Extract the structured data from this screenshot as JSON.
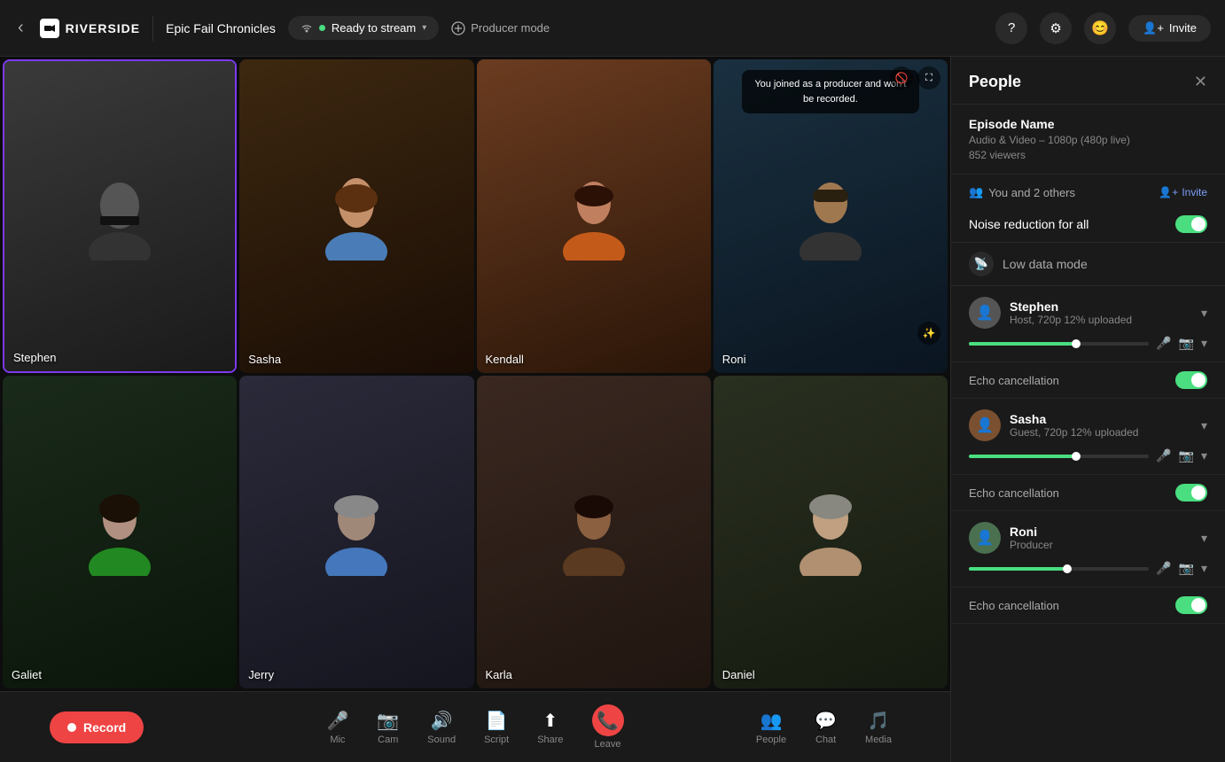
{
  "header": {
    "back_icon": "‹",
    "logo_text": "RIVERSIDE",
    "episode_name": "Epic Fail Chronicles",
    "stream_status": "Ready to stream",
    "producer_mode": "Producer mode",
    "invite_label": "Invite",
    "icons": [
      "?",
      "⚙",
      "😊"
    ]
  },
  "video_grid": [
    {
      "id": "stephen",
      "label": "Stephen",
      "active": true,
      "class": "vc-stephen"
    },
    {
      "id": "sasha",
      "label": "Sasha",
      "active": false,
      "class": "vc-sasha"
    },
    {
      "id": "kendall",
      "label": "Kendall",
      "active": false,
      "class": "vc-kendall"
    },
    {
      "id": "roni",
      "label": "Roni",
      "active": false,
      "class": "vc-roni",
      "overlay": "You joined as a producer and won't be recorded."
    },
    {
      "id": "galiet",
      "label": "Galiet",
      "active": false,
      "class": "vc-galiet"
    },
    {
      "id": "jerry",
      "label": "Jerry",
      "active": false,
      "class": "vc-jerry"
    },
    {
      "id": "karla",
      "label": "Karla",
      "active": false,
      "class": "vc-karla"
    },
    {
      "id": "daniel",
      "label": "Daniel",
      "active": false,
      "class": "vc-daniel"
    }
  ],
  "toolbar": {
    "record_label": "Record",
    "mic_label": "Mic",
    "cam_label": "Cam",
    "sound_label": "Sound",
    "script_label": "Script",
    "share_label": "Share",
    "leave_label": "Leave",
    "people_label": "People",
    "chat_label": "Chat",
    "media_label": "Media"
  },
  "panel": {
    "title": "People",
    "episode_name_label": "Episode Name",
    "quality": "Audio & Video – 1080p (480p live)",
    "viewers": "852 viewers",
    "participants": "You and 2 others",
    "invite_label": "Invite",
    "noise_reduction_label": "Noise reduction for all",
    "low_data_label": "Low data mode",
    "echo_cancellation_label": "Echo cancellation",
    "people": [
      {
        "name": "Stephen",
        "role": "Host, 720p 12% uploaded",
        "progress": 60
      },
      {
        "name": "Sasha",
        "role": "Guest, 720p 12% uploaded",
        "progress": 60
      },
      {
        "name": "Roni",
        "role": "Producer",
        "progress": 55
      }
    ]
  }
}
